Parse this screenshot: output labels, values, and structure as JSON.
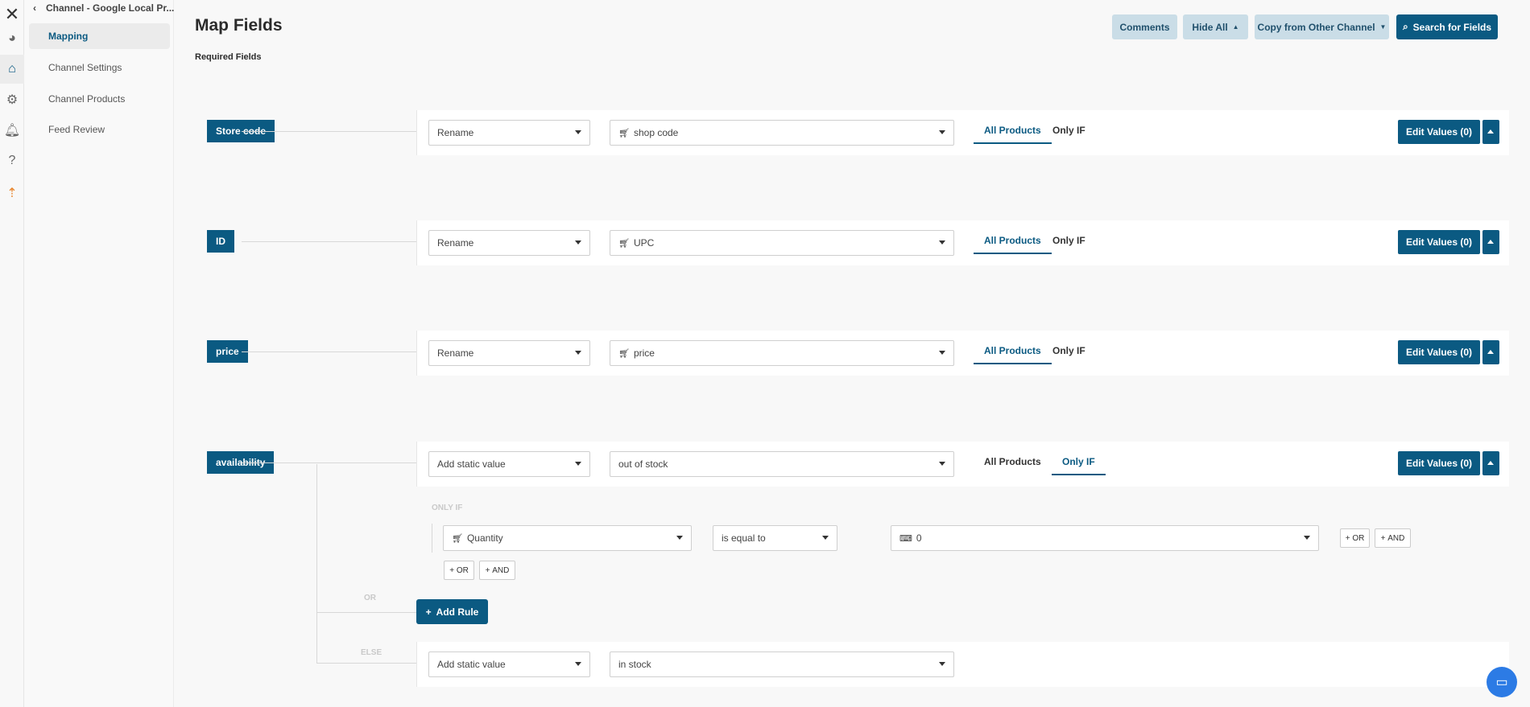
{
  "rail": {
    "icons": [
      "close-icon",
      "dashboard-icon",
      "store-icon",
      "gear-icon",
      "bell-icon",
      "help-icon",
      "upload-icon"
    ]
  },
  "sidebar": {
    "title": "Channel - Google Local Pr...",
    "items": [
      {
        "label": "Mapping",
        "active": true
      },
      {
        "label": "Channel Settings"
      },
      {
        "label": "Channel Products"
      },
      {
        "label": "Feed Review"
      }
    ]
  },
  "header": {
    "title": "Map Fields",
    "subtitle": "Required Fields",
    "buttons": {
      "comments": "Comments",
      "hide_all": "Hide All",
      "copy": "Copy from Other Channel",
      "search": "Search for Fields"
    }
  },
  "fields": [
    {
      "label": "Store code",
      "action": "Rename",
      "value": "shop code",
      "tab_all": "All Products",
      "tab_if": "Only IF",
      "active_tab": "All Products",
      "edit": "Edit Values (0)"
    },
    {
      "label": "ID",
      "action": "Rename",
      "value": "UPC",
      "tab_all": "All Products",
      "tab_if": "Only IF",
      "active_tab": "All Products",
      "edit": "Edit Values (0)"
    },
    {
      "label": "price",
      "action": "Rename",
      "value": "price",
      "tab_all": "All Products",
      "tab_if": "Only IF",
      "active_tab": "All Products",
      "edit": "Edit Values (0)"
    },
    {
      "label": "availability",
      "action": "Add static value",
      "value": "out of stock",
      "tab_all": "All Products",
      "tab_if": "Only IF",
      "active_tab": "Only IF",
      "edit": "Edit Values (0)"
    }
  ],
  "condition": {
    "heading": "ONLY IF",
    "field": "Quantity",
    "operator": "is equal to",
    "value": "0",
    "or": "OR",
    "and": "AND"
  },
  "or_label": "OR",
  "add_rule": "Add Rule",
  "else_label": "ELSE",
  "else_rule": {
    "action": "Add static value",
    "value": "in stock"
  },
  "colors": {
    "primary": "#0b5a82",
    "secondary": "#cadde7",
    "accent": "#e8832a"
  }
}
